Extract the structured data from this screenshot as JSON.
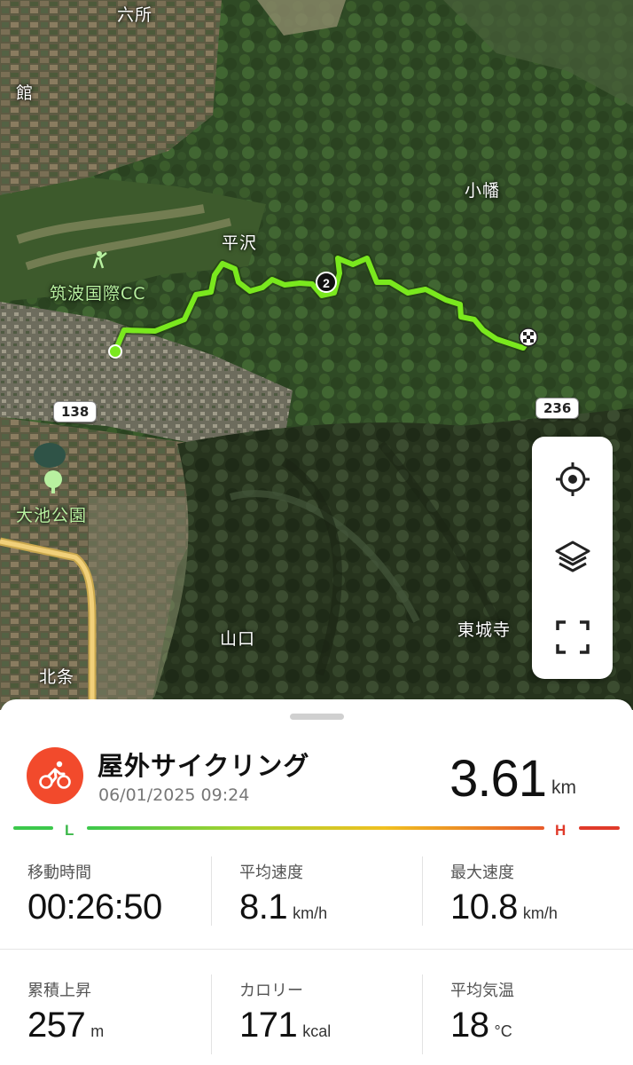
{
  "map": {
    "places": {
      "rokusho": "六所",
      "tachi": "館",
      "obata": "小幡",
      "hirasawa": "平沢",
      "golf": "筑波国際CC",
      "park": "大池公園",
      "yamaguchi": "山口",
      "tojoji": "東城寺",
      "hojo": "北条"
    },
    "roads": {
      "r138": "138",
      "r236": "236"
    },
    "marker_label": "2",
    "controls": [
      "locate-icon",
      "layers-icon",
      "fullscreen-icon"
    ]
  },
  "activity": {
    "title": "屋外サイクリング",
    "date": "06/01/2025 09:24",
    "icon": "bicycle-icon",
    "distance": "3.61",
    "distance_unit": "km"
  },
  "scale": {
    "low": "L",
    "high": "H"
  },
  "stats": {
    "moving_time": {
      "label": "移動時間",
      "value": "00:26:50",
      "unit": ""
    },
    "avg_speed": {
      "label": "平均速度",
      "value": "8.1",
      "unit": "km/h"
    },
    "max_speed": {
      "label": "最大速度",
      "value": "10.8",
      "unit": "km/h"
    },
    "elevation_gain": {
      "label": "累積上昇",
      "value": "257",
      "unit": "m"
    },
    "calories": {
      "label": "カロリー",
      "value": "171",
      "unit": "kcal"
    },
    "avg_temp": {
      "label": "平均気温",
      "value": "18",
      "unit": "°C"
    }
  },
  "colors": {
    "accent": "#f24a2c",
    "route": "#7ae81e",
    "low": "#3cb84a",
    "high": "#e03a2a"
  }
}
